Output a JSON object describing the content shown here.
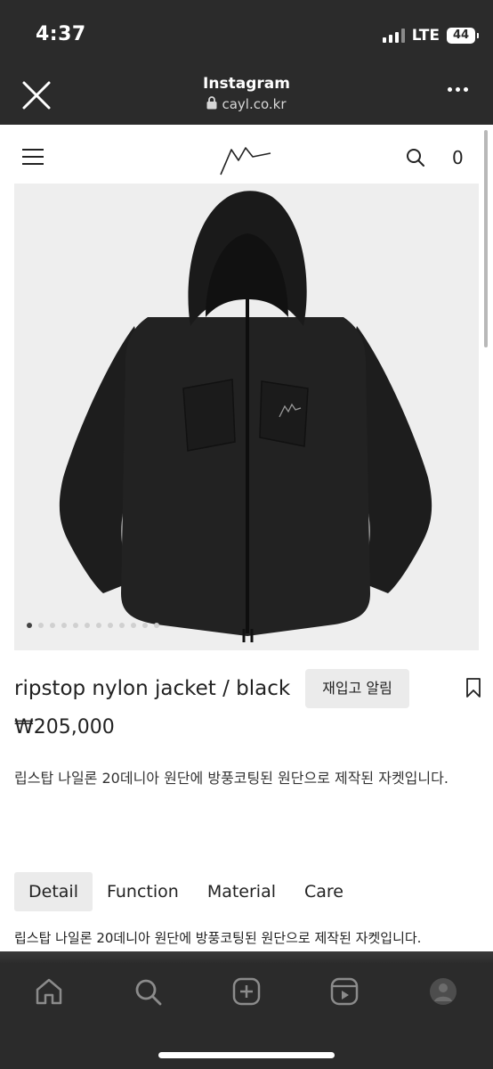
{
  "status_bar": {
    "time": "4:37",
    "network": "LTE",
    "battery": "44"
  },
  "browser": {
    "title": "Instagram",
    "url": "cayl.co.kr"
  },
  "site": {
    "cart_count": "0"
  },
  "product": {
    "name": "ripstop nylon jacket / black",
    "restock_button": "재입고 알림",
    "price": "₩205,000",
    "description": "립스탑 나일론 20데니아 원단에 방풍코팅된 원단으로 제작된 자켓입니다.",
    "image_count": 12,
    "active_image": 1
  },
  "tabs": [
    {
      "label": "Detail",
      "active": true
    },
    {
      "label": "Function",
      "active": false
    },
    {
      "label": "Material",
      "active": false
    },
    {
      "label": "Care",
      "active": false
    }
  ],
  "tab_content": "립스탑 나일론 20데니아 원단에 방풍코팅된 원단으로 제작된 자켓입니다.",
  "bottom_nav": [
    "home-icon",
    "search-icon",
    "create-icon",
    "reels-icon",
    "profile-icon"
  ]
}
